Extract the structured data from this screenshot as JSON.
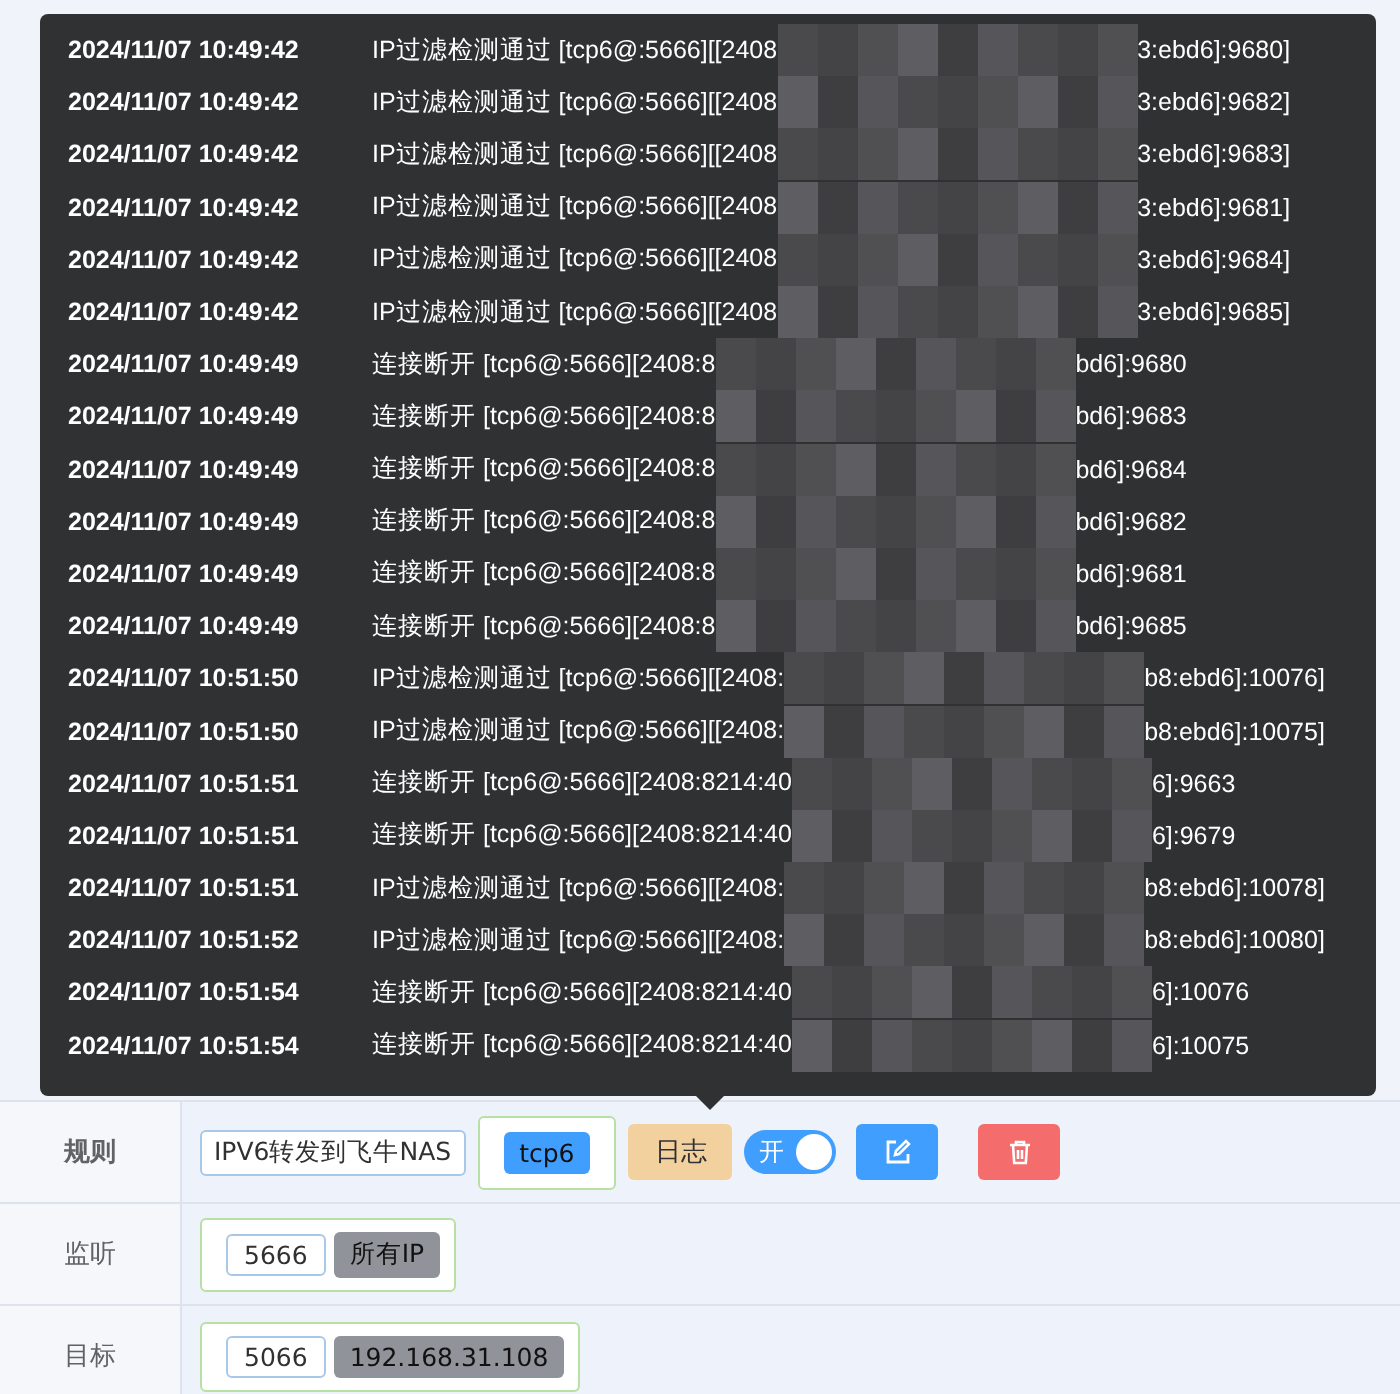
{
  "log_tooltip": {
    "entries": [
      {
        "time": "2024/11/07 10:49:42",
        "message_start": "IP过滤检测通过 [tcp6@:5666][[2408",
        "message_end": "3:ebd6]:9680]"
      },
      {
        "time": "2024/11/07 10:49:42",
        "message_start": "IP过滤检测通过 [tcp6@:5666][[2408",
        "message_end": "3:ebd6]:9682]"
      },
      {
        "time": "2024/11/07 10:49:42",
        "message_start": "IP过滤检测通过 [tcp6@:5666][[2408",
        "message_end": "3:ebd6]:9683]"
      },
      {
        "time": "2024/11/07 10:49:42",
        "message_start": "IP过滤检测通过 [tcp6@:5666][[2408",
        "message_end": "3:ebd6]:9681]"
      },
      {
        "time": "2024/11/07 10:49:42",
        "message_start": "IP过滤检测通过 [tcp6@:5666][[2408",
        "message_end": "3:ebd6]:9684]"
      },
      {
        "time": "2024/11/07 10:49:42",
        "message_start": "IP过滤检测通过 [tcp6@:5666][[2408",
        "message_end": "3:ebd6]:9685]"
      },
      {
        "time": "2024/11/07 10:49:49",
        "message_start": "连接断开 [tcp6@:5666][2408:8",
        "message_end": "bd6]:9680"
      },
      {
        "time": "2024/11/07 10:49:49",
        "message_start": "连接断开 [tcp6@:5666][2408:8",
        "message_end": "bd6]:9683"
      },
      {
        "time": "2024/11/07 10:49:49",
        "message_start": "连接断开 [tcp6@:5666][2408:8",
        "message_end": "bd6]:9684"
      },
      {
        "time": "2024/11/07 10:49:49",
        "message_start": "连接断开 [tcp6@:5666][2408:8",
        "message_end": "bd6]:9682"
      },
      {
        "time": "2024/11/07 10:49:49",
        "message_start": "连接断开 [tcp6@:5666][2408:8",
        "message_end": "bd6]:9681"
      },
      {
        "time": "2024/11/07 10:49:49",
        "message_start": "连接断开 [tcp6@:5666][2408:8",
        "message_end": "bd6]:9685"
      },
      {
        "time": "2024/11/07 10:51:50",
        "message_start": "IP过滤检测通过 [tcp6@:5666][[2408:",
        "message_end": "b8:ebd6]:10076]"
      },
      {
        "time": "2024/11/07 10:51:50",
        "message_start": "IP过滤检测通过 [tcp6@:5666][[2408:",
        "message_end": "b8:ebd6]:10075]"
      },
      {
        "time": "2024/11/07 10:51:51",
        "message_start": "连接断开 [tcp6@:5666][2408:8214:40",
        "message_end": "6]:9663"
      },
      {
        "time": "2024/11/07 10:51:51",
        "message_start": "连接断开 [tcp6@:5666][2408:8214:40",
        "message_end": "6]:9679"
      },
      {
        "time": "2024/11/07 10:51:51",
        "message_start": "IP过滤检测通过 [tcp6@:5666][[2408:",
        "message_end": "b8:ebd6]:10078]"
      },
      {
        "time": "2024/11/07 10:51:52",
        "message_start": "IP过滤检测通过 [tcp6@:5666][[2408:",
        "message_end": "b8:ebd6]:10080]"
      },
      {
        "time": "2024/11/07 10:51:54",
        "message_start": "连接断开 [tcp6@:5666][2408:8214:40",
        "message_end": "6]:10076"
      },
      {
        "time": "2024/11/07 10:51:54",
        "message_start": "连接断开 [tcp6@:5666][2408:8214:40",
        "message_end": "6]:10075"
      }
    ]
  },
  "form": {
    "rule": {
      "label": "规则",
      "name": "IPV6转发到飞牛NAS",
      "protocol": "tcp6",
      "log_button": "日志",
      "switch": {
        "label": "开",
        "on": true
      }
    },
    "listen": {
      "label": "监听",
      "port": "5666",
      "address": "所有IP"
    },
    "target": {
      "label": "目标",
      "port": "5066",
      "address": "192.168.31.108"
    }
  }
}
